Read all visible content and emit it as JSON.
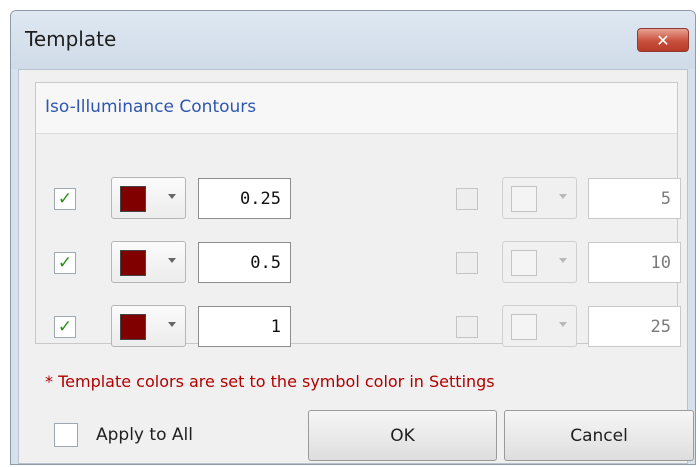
{
  "window": {
    "title": "Template",
    "close_label": "✕"
  },
  "group": {
    "title": "Iso-Illuminance Contours"
  },
  "rows": [
    {
      "checked": true,
      "color": "#800000",
      "value": "0.25",
      "enabled": true
    },
    {
      "checked": true,
      "color": "#800000",
      "value": "0.5",
      "enabled": true
    },
    {
      "checked": true,
      "color": "#800000",
      "value": "1",
      "enabled": true
    },
    {
      "checked": false,
      "color": null,
      "value": "5",
      "enabled": false
    },
    {
      "checked": false,
      "color": null,
      "value": "10",
      "enabled": false
    },
    {
      "checked": false,
      "color": null,
      "value": "25",
      "enabled": false
    }
  ],
  "note": "* Template colors are set to the symbol color in Settings",
  "apply_all": {
    "label": "Apply to All",
    "checked": false
  },
  "buttons": {
    "ok": "OK",
    "cancel": "Cancel"
  }
}
